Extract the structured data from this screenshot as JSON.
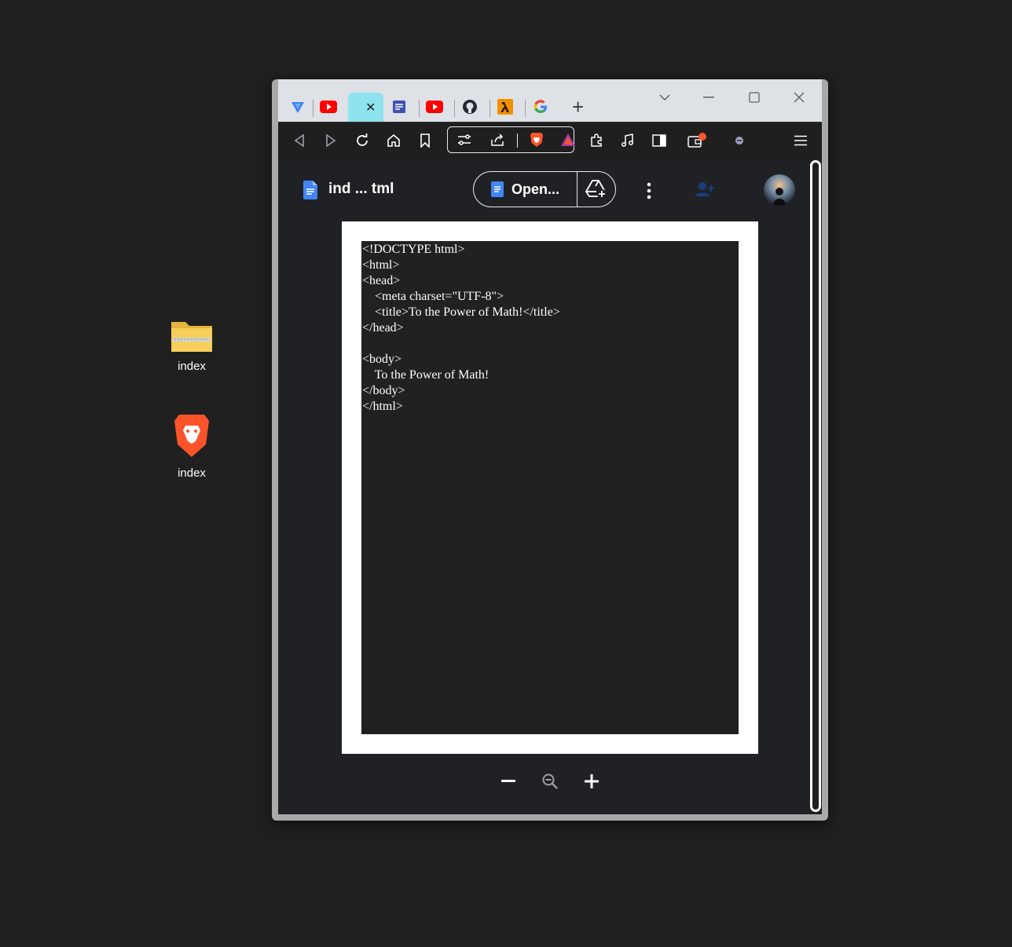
{
  "desktop": {
    "icons": [
      {
        "label": "index",
        "icon": "zip-folder-icon"
      },
      {
        "label": "index",
        "icon": "brave-browser-icon"
      }
    ]
  },
  "browser": {
    "tabs": [
      {
        "icon": "proton-vpn-icon"
      },
      {
        "icon": "youtube-icon"
      },
      {
        "icon": "blank-tab-icon",
        "active": true,
        "close": "✕"
      },
      {
        "icon": "notes-icon"
      },
      {
        "icon": "youtube-icon"
      },
      {
        "icon": "github-icon"
      },
      {
        "icon": "lambda-icon"
      },
      {
        "icon": "google-icon"
      }
    ],
    "new_tab": "+",
    "window_controls": {
      "dropdown": "⌄",
      "minimize": "—",
      "maximize": "☐",
      "close": "✕"
    },
    "toolbar": [
      "back",
      "forward",
      "reload",
      "home",
      "bookmark",
      "tune",
      "share",
      "brave-shields",
      "brave-rewards",
      "extensions",
      "music",
      "sidebar",
      "wallet",
      "vpn",
      "menu"
    ]
  },
  "drive_preview": {
    "title": "ind ... tml",
    "open_button": "Open...",
    "doc_lines": [
      "<!DOCTYPE html>",
      "<html>",
      "<head>",
      "    <meta charset=\"UTF-8\">",
      "    <title>To the Power of Math!</title>",
      "</head>",
      "",
      "<body>",
      "    To the Power of Math!",
      "</body>",
      "</html>"
    ],
    "zoom": {
      "out": "−",
      "in": "+"
    }
  },
  "colors": {
    "desktop_bg": "#202020",
    "tabbar_bg": "#dee1e6",
    "active_tab": "#8fe3ee",
    "content_bg": "#202124",
    "accent_blue": "#4285f4"
  }
}
